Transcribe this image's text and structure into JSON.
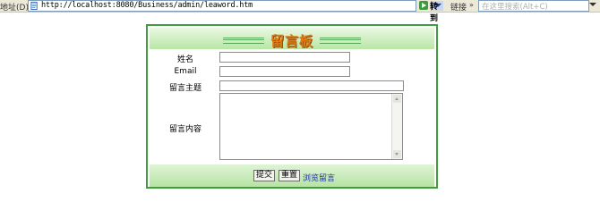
{
  "browser": {
    "address_label": "地址(D)",
    "url": "http://localhost:8080/Business/admin/leaword.htm",
    "go_label": "转到",
    "links_label": "链接",
    "links_chevron": "»",
    "search_placeholder": "在这里搜索(Alt+C)"
  },
  "form": {
    "title": "留言板",
    "fields": {
      "name_label": "姓名",
      "email_label": "Email",
      "subject_label": "留言主题",
      "content_label": "留言内容"
    },
    "values": {
      "name": "",
      "email": "",
      "subject": "",
      "content": ""
    },
    "buttons": {
      "submit": "提交",
      "reset": "重置",
      "browse_link": "浏览留言"
    }
  },
  "colors": {
    "border": "#3f9d3f",
    "header_gradient_top": "#e9f8e2",
    "header_gradient_bottom": "#b9e6a6",
    "title": "#e07a10",
    "link": "#1c2fa8"
  },
  "icons": [
    "page-icon",
    "dropdown-arrow-icon",
    "go-arrow-icon",
    "search-dropdown-icon"
  ]
}
